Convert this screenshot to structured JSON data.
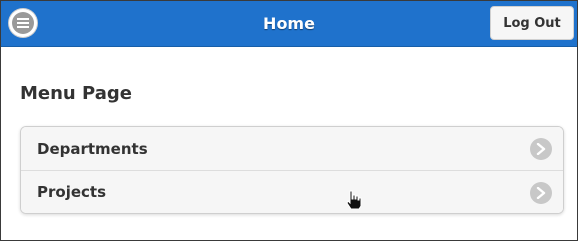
{
  "header": {
    "title": "Home",
    "logout_label": "Log Out",
    "menu_icon": "hamburger-icon",
    "color": "#1f72cc"
  },
  "main": {
    "heading": "Menu Page",
    "items": [
      {
        "label": "Departments",
        "icon": "chevron-right-icon"
      },
      {
        "label": "Projects",
        "icon": "chevron-right-icon"
      }
    ]
  }
}
